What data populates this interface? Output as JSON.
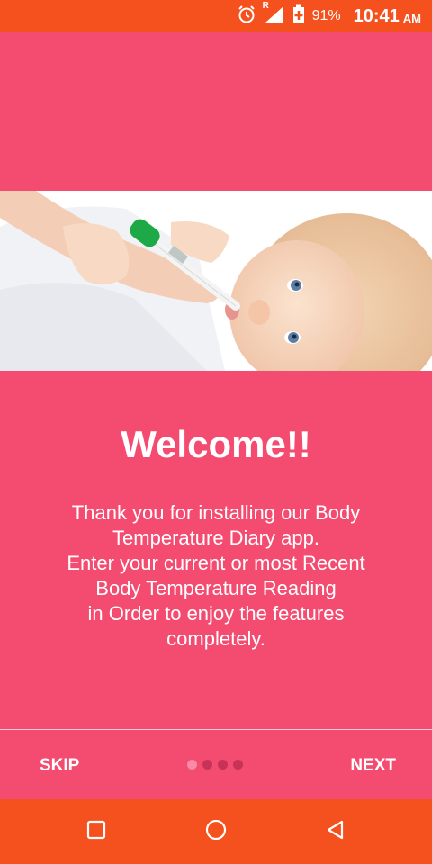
{
  "status_bar": {
    "alarm_icon": "alarm-icon",
    "roaming_label": "R",
    "signal_icon": "signal-icon",
    "battery_icon": "battery-charging-icon",
    "battery_percent": "91%",
    "time": "10:41",
    "ampm": "AM"
  },
  "onboarding": {
    "hero_image": "baby-with-thermometer",
    "title": "Welcome!!",
    "lines": [
      "Thank you for installing our Body",
      "Temperature Diary app.",
      "Enter your current or most Recent",
      "Body Temperature Reading",
      "in Order to enjoy the features",
      "completely."
    ]
  },
  "footer": {
    "skip_label": "SKIP",
    "next_label": "NEXT",
    "page_count": 4,
    "current_page": 1
  },
  "nav_bar": {
    "recents_icon": "square-recents-icon",
    "home_icon": "circle-home-icon",
    "back_icon": "triangle-back-icon"
  },
  "colors": {
    "status_bar": "#F5511E",
    "background": "#F44B70",
    "text": "#FFFFFF"
  }
}
